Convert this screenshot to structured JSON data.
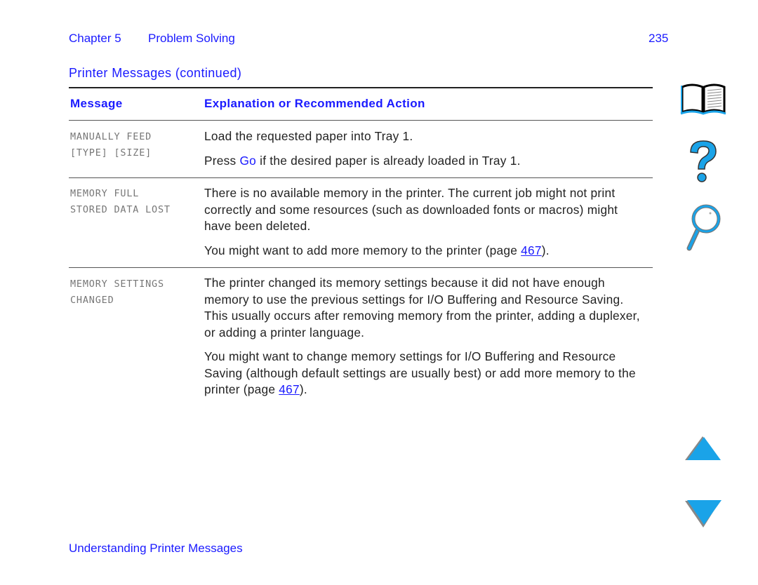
{
  "header": {
    "chapter": "Chapter 5",
    "section": "Problem Solving",
    "page_number": "235"
  },
  "section_title": "Printer Messages (continued)",
  "table": {
    "columns": [
      "Message",
      "Explanation or Recommended Action"
    ],
    "rows": [
      {
        "message_lines": [
          "MANUALLY FEED",
          "[TYPE] [SIZE]"
        ],
        "p1": "Load the requested paper into Tray 1.",
        "p2_pre": "Press ",
        "p2_key": "Go",
        "p2_post": " if the desired paper is already loaded in Tray 1."
      },
      {
        "message_lines": [
          "MEMORY FULL",
          "STORED DATA LOST"
        ],
        "p1": "There is no available memory in the printer. The current job might not print correctly and some resources (such as downloaded fonts or macros) might have been deleted.",
        "p2_pre": "You might want to add more memory to the printer (page ",
        "p2_link": "467",
        "p2_post": ")."
      },
      {
        "message_lines": [
          "MEMORY SETTINGS",
          "CHANGED"
        ],
        "p1": "The printer changed its memory settings because it did not have enough memory to use the previous settings for I/O Buffering and Resource Saving. This usually occurs after removing memory from the printer, adding a duplexer, or adding a printer language.",
        "p2_pre": "You might want to change memory settings for I/O Buffering and Resource Saving (although default settings are usually best) or add more memory to the printer (page ",
        "p2_link": "467",
        "p2_post": ")."
      }
    ]
  },
  "footer": "Understanding Printer Messages",
  "nav_icons": [
    "book-icon",
    "help-question-icon",
    "search-magnifier-icon",
    "previous-page-arrow-icon",
    "next-page-arrow-icon"
  ],
  "colors": {
    "accent": "#1a1aff",
    "icon_blue": "#1aa3e8",
    "message_gray": "#777777"
  }
}
